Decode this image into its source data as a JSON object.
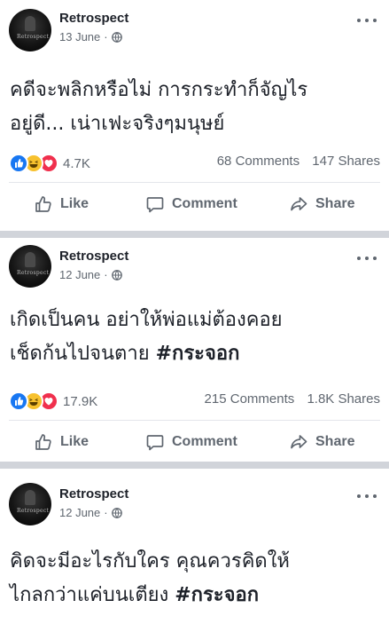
{
  "posts": [
    {
      "page_name": "Retrospect",
      "date": "13 June",
      "avatar_text": "Retrospect",
      "lines": [
        {
          "text": "คดีจะพลิกหรือไม่ การกระทำก็จัญไร",
          "tag": ""
        },
        {
          "text": "อยู่ดี... เน่าเฟะจริงๆมนุษย์",
          "tag": ""
        }
      ],
      "reaction_count": "4.7K",
      "comments": "68 Comments",
      "shares": "147 Shares"
    },
    {
      "page_name": "Retrospect",
      "date": "12 June",
      "avatar_text": "Retrospect",
      "lines": [
        {
          "text": "เกิดเป็นคน อย่าให้พ่อแม่ต้องคอย",
          "tag": ""
        },
        {
          "text": "เช็ดก้นไปจนตาย ",
          "tag": "#กระจอก"
        }
      ],
      "reaction_count": "17.9K",
      "comments": "215 Comments",
      "shares": "1.8K Shares"
    },
    {
      "page_name": "Retrospect",
      "date": "12 June",
      "avatar_text": "Retrospect",
      "lines": [
        {
          "text": "คิดจะมีอะไรกับใคร คุณควรคิดให้",
          "tag": ""
        },
        {
          "text": "ไกลกว่าแค่บนเตียง ",
          "tag": "#กระจอก"
        }
      ]
    }
  ],
  "actions": {
    "like": "Like",
    "comment": "Comment",
    "share": "Share"
  },
  "date_separator": "·",
  "icons": {
    "privacy": "globe-icon",
    "more": "more-options-icon",
    "like": "thumbs-up-icon",
    "comment": "comment-bubble-icon",
    "share": "share-arrow-icon",
    "reactions": [
      "like-reaction-icon",
      "haha-reaction-icon",
      "love-reaction-icon"
    ]
  },
  "colors": {
    "text": "#1d2129",
    "secondary": "#606770",
    "like_blue": "#1877f2",
    "haha_yellow": "#f7c12e",
    "love_red": "#f0304d",
    "separator": "#d1d4da"
  }
}
